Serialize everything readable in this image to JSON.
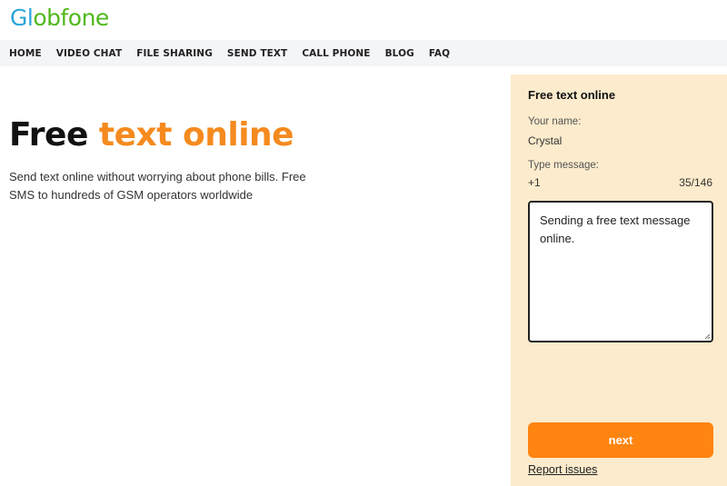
{
  "brand": {
    "logo_part1": "Gl",
    "logo_part2": "obfone",
    "colors": {
      "blue": "#29a6d9",
      "green": "#4fb81c"
    }
  },
  "nav": {
    "items": [
      "HOME",
      "VIDEO CHAT",
      "FILE SHARING",
      "SEND TEXT",
      "CALL PHONE",
      "BLOG",
      "FAQ"
    ]
  },
  "hero": {
    "title_plain": "Free",
    "title_accent": "text online",
    "description": "Send text online without worrying about phone bills. Free SMS to hundreds of GSM operators worldwide",
    "accent_color": "#f58a1f"
  },
  "form": {
    "title": "Free text online",
    "name_label": "Your name:",
    "name_value": "Crystal",
    "message_label": "Type message:",
    "country_code": "+1",
    "char_count": "35/146",
    "message_value": "Sending a free text message online.",
    "next_label": "next",
    "report_label": "Report issues",
    "colors": {
      "panel_bg": "#fcebcc",
      "button": "#ff8410"
    }
  }
}
